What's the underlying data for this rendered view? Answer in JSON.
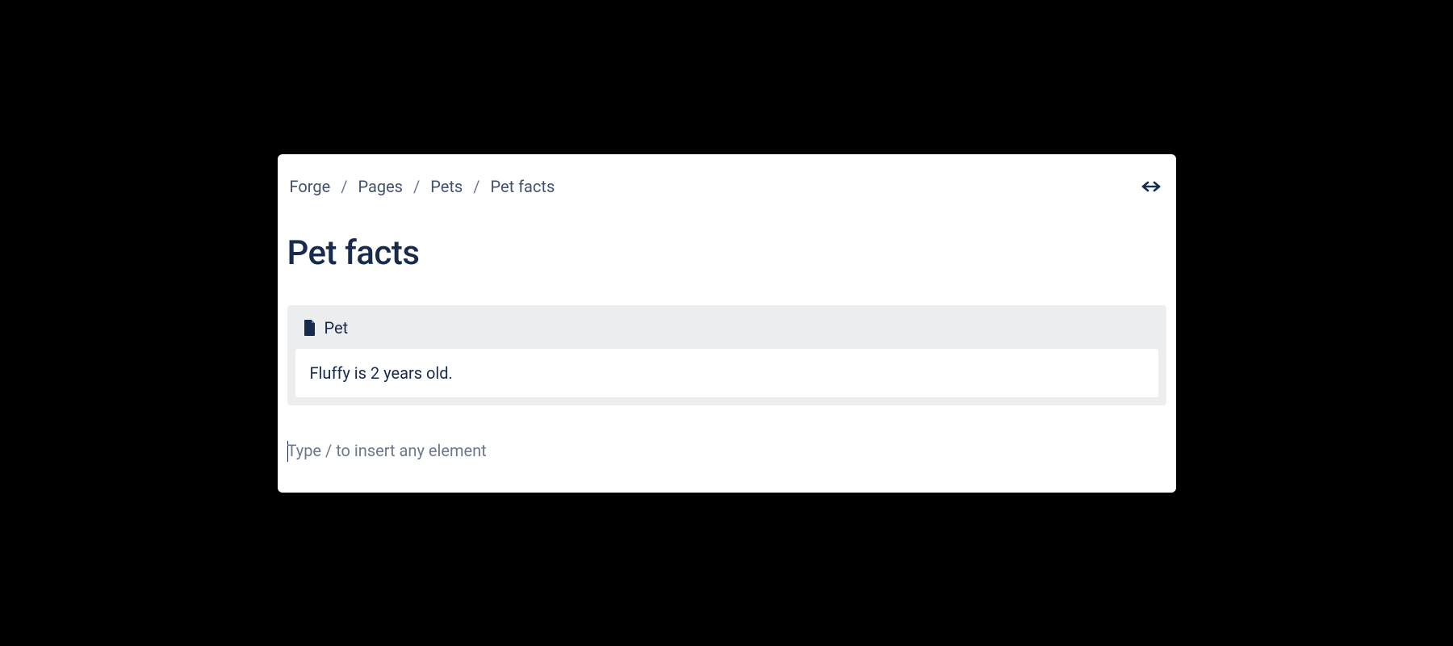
{
  "breadcrumb": {
    "items": [
      {
        "label": "Forge"
      },
      {
        "label": "Pages"
      },
      {
        "label": "Pets"
      },
      {
        "label": "Pet facts"
      }
    ],
    "separator": "/"
  },
  "page": {
    "title": "Pet facts"
  },
  "macro": {
    "label": "Pet",
    "content": "Fluffy is 2 years old."
  },
  "editor": {
    "placeholder": "Type / to insert any element"
  }
}
